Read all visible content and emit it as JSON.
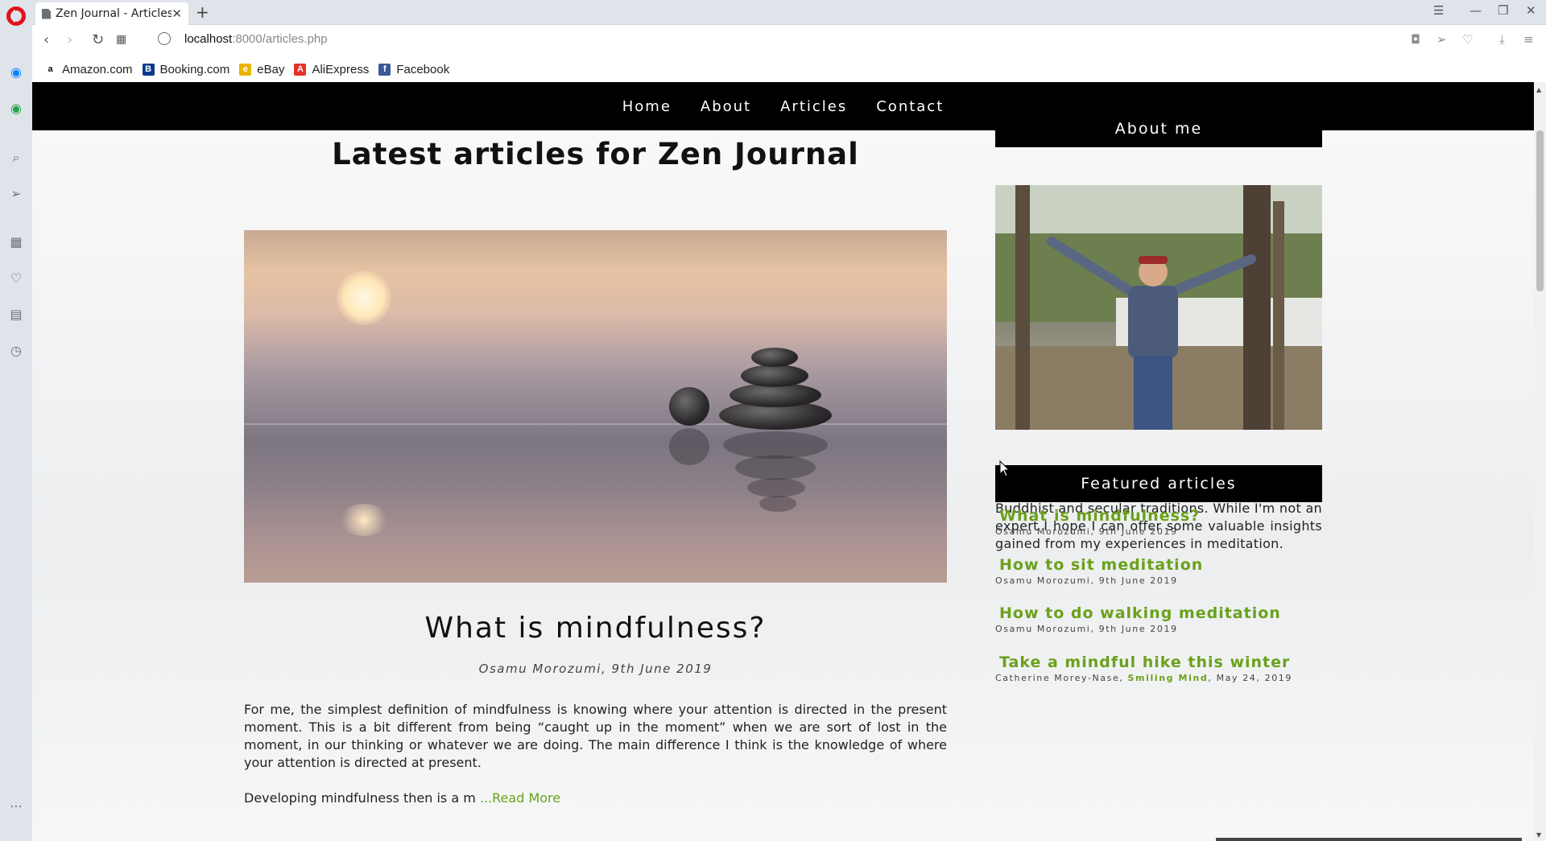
{
  "browser": {
    "tab_title": "Zen Journal - Articles",
    "url_host": "localhost",
    "url_path": ":8000/articles.php",
    "bookmarks": [
      {
        "label": "Amazon.com",
        "icon": "amazon-icon",
        "color": "#ffffff",
        "glyph": "a"
      },
      {
        "label": "Booking.com",
        "icon": "booking-icon",
        "color": "#0c3b8c",
        "glyph": "B"
      },
      {
        "label": "eBay",
        "icon": "ebay-icon",
        "color": "#e8b400",
        "glyph": "e"
      },
      {
        "label": "AliExpress",
        "icon": "aliexpress-icon",
        "color": "#e43225",
        "glyph": "A"
      },
      {
        "label": "Facebook",
        "icon": "facebook-icon",
        "color": "#3b5998",
        "glyph": "f"
      }
    ]
  },
  "site": {
    "nav": [
      "Home",
      "About",
      "Articles",
      "Contact"
    ],
    "heading": "Latest articles for Zen Journal",
    "accent_color": "#6aa11b"
  },
  "article": {
    "title": "What is mindfulness?",
    "meta": "Osamu Morozumi, 9th June 2019",
    "body": "For me, the simplest definition of mindfulness is knowing where your attention is directed in the present moment. This is a bit different from being “caught up in the moment” when we are sort of lost in the moment, in our thinking or whatever we are doing. The main difference I think is the knowledge of where your attention is directed at present.",
    "excerpt": "Developing mindfulness then is a m",
    "read_more": " ...Read More"
  },
  "aside": {
    "about_heading": "About me",
    "about_text": "Hi, I'm Osamu. I've been meditating my whole adult life, following both the Theravada Buddhist and secular traditions. While I'm not an expert I hope I can offer some valuable insights gained from my experiences in meditation.",
    "featured_heading": "Featured articles",
    "featured": [
      {
        "title": "What is mindfulness?",
        "meta": "Osamu Morozumi, 9th June 2019"
      },
      {
        "title": "How to sit meditation",
        "meta": "Osamu Morozumi, 9th June 2019"
      },
      {
        "title": "How to do walking meditation",
        "meta": "Osamu Morozumi, 9th June 2019"
      },
      {
        "title": "Take a mindful hike this winter",
        "meta_pre": "Catherine Morey-Nase, ",
        "meta_src": "Smiling Mind",
        "meta_post": ", May 24, 2019"
      }
    ]
  }
}
